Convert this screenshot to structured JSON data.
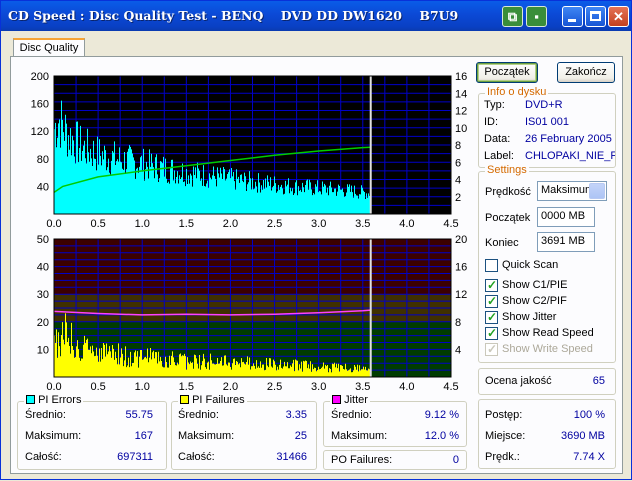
{
  "window": {
    "title": "CD Speed : Disc Quality Test - BENQ    DVD DD DW1620    B7U9"
  },
  "tab": {
    "label": "Disc Quality"
  },
  "buttons": {
    "start": "Początek",
    "finish": "Zakończ"
  },
  "disc_info": {
    "title": "Info o dysku",
    "rows": [
      {
        "label": "Typ:",
        "value": "DVD+R"
      },
      {
        "label": "ID:",
        "value": "IS01 001"
      },
      {
        "label": "Data:",
        "value": "26 February 2005"
      },
      {
        "label": "Label:",
        "value": "CHLOPAKI_NIE_F"
      }
    ]
  },
  "settings": {
    "title": "Settings",
    "speed_label": "Prędkość",
    "speed_value": "Maksimum",
    "start_label": "Początek",
    "start_value": "0000 MB",
    "end_label": "Koniec",
    "end_value": "3691 MB",
    "checkboxes": [
      {
        "label": "Quick Scan",
        "checked": false,
        "enabled": true
      },
      {
        "label": "Show C1/PIE",
        "checked": true,
        "enabled": true
      },
      {
        "label": "Show C2/PIF",
        "checked": true,
        "enabled": true
      },
      {
        "label": "Show Jitter",
        "checked": true,
        "enabled": true
      },
      {
        "label": "Show Read Speed",
        "checked": true,
        "enabled": true
      },
      {
        "label": "Show Write Speed",
        "checked": true,
        "enabled": false
      }
    ]
  },
  "quality": {
    "label": "Ocena jakość",
    "value": "65"
  },
  "progress": {
    "rows": [
      {
        "label": "Postęp:",
        "value": "100 %"
      },
      {
        "label": "Miejsce:",
        "value": "3690 MB"
      },
      {
        "label": "Prędk.:",
        "value": "7.74 X"
      }
    ]
  },
  "pi_errors": {
    "title": "PI Errors",
    "color": "#00ffff",
    "rows": [
      {
        "label": "Średnio:",
        "value": "55.75"
      },
      {
        "label": "Maksimum:",
        "value": "167"
      },
      {
        "label": "Całość:",
        "value": "697311"
      }
    ]
  },
  "pi_failures": {
    "title": "PI Failures",
    "color": "#ffff00",
    "rows": [
      {
        "label": "Średnio:",
        "value": "3.35"
      },
      {
        "label": "Maksimum:",
        "value": "25"
      },
      {
        "label": "Całość:",
        "value": "31466"
      }
    ]
  },
  "jitter": {
    "title": "Jitter",
    "color": "#ff00ff",
    "rows": [
      {
        "label": "Średnio:",
        "value": "9.12 %"
      },
      {
        "label": "Maksimum:",
        "value": "12.0 %"
      }
    ],
    "po_label": "PO Failures:",
    "po_value": "0"
  },
  "chart_data": [
    {
      "type": "area",
      "x_ticks": [
        "0.0",
        "0.5",
        "1.0",
        "1.5",
        "2.0",
        "2.5",
        "3.0",
        "3.5",
        "4.0",
        "4.5"
      ],
      "y_left_ticks": [
        "200",
        "160",
        "120",
        "80",
        "40"
      ],
      "y_right_ticks": [
        "16",
        "14",
        "12",
        "10",
        "8",
        "6",
        "4",
        "2"
      ],
      "xlim": [
        0,
        4.5
      ],
      "ylim_left": [
        0,
        200
      ],
      "ylim_right": [
        0,
        16
      ],
      "end_marker": 3.59,
      "colors": {
        "background": "#000000",
        "grid": "#0000c8",
        "pie": "#00ffff",
        "speed": "#00cc00",
        "marker": "#e0e0e0"
      },
      "series": [
        {
          "name": "PI Errors",
          "axis": "left",
          "envelope": [
            [
              0.0,
              150
            ],
            [
              0.05,
              167
            ],
            [
              0.15,
              140
            ],
            [
              0.3,
              118
            ],
            [
              0.5,
              105
            ],
            [
              0.75,
              95
            ],
            [
              1.0,
              88
            ],
            [
              1.25,
              80
            ],
            [
              1.5,
              73
            ],
            [
              1.75,
              67
            ],
            [
              2.0,
              61
            ],
            [
              2.25,
              56
            ],
            [
              2.5,
              52
            ],
            [
              2.75,
              48
            ],
            [
              3.0,
              45
            ],
            [
              3.25,
              42
            ],
            [
              3.5,
              38
            ],
            [
              3.59,
              36
            ]
          ]
        },
        {
          "name": "Read Speed",
          "axis": "right",
          "points": [
            [
              0.0,
              2.5
            ],
            [
              0.1,
              3.2
            ],
            [
              0.5,
              4.3
            ],
            [
              1.0,
              5.0
            ],
            [
              1.5,
              5.6
            ],
            [
              2.0,
              6.2
            ],
            [
              2.5,
              6.8
            ],
            [
              3.0,
              7.3
            ],
            [
              3.5,
              7.7
            ],
            [
              3.59,
              7.74
            ]
          ]
        }
      ]
    },
    {
      "type": "area",
      "x_ticks": [
        "0.0",
        "0.5",
        "1.0",
        "1.5",
        "2.0",
        "2.5",
        "3.0",
        "3.5",
        "4.0",
        "4.5"
      ],
      "y_left_ticks": [
        "50",
        "40",
        "30",
        "20",
        "10"
      ],
      "y_right_ticks": [
        "20",
        "16",
        "12",
        "8",
        "4"
      ],
      "xlim": [
        0,
        4.5
      ],
      "ylim_left": [
        0,
        50
      ],
      "ylim_right": [
        0,
        20
      ],
      "end_marker": 3.59,
      "colors": {
        "band_high": "#3c0000",
        "band_mid": "#403000",
        "band_low": "#003c00",
        "grid": "#0000c8",
        "pif": "#ffff00",
        "jitter": "#ff40ff",
        "marker": "#e0e0e0"
      },
      "bands": [
        {
          "from": 0,
          "to": 8,
          "color": "band_low"
        },
        {
          "from": 8,
          "to": 12,
          "color": "band_mid"
        },
        {
          "from": 12,
          "to": 20,
          "color": "band_high"
        }
      ],
      "series": [
        {
          "name": "PI Failures",
          "axis": "left",
          "envelope": [
            [
              0.0,
              18
            ],
            [
              0.1,
              22
            ],
            [
              0.25,
              16
            ],
            [
              0.5,
              13
            ],
            [
              0.75,
              11
            ],
            [
              1.0,
              10
            ],
            [
              1.25,
              9
            ],
            [
              1.5,
              8
            ],
            [
              1.75,
              8
            ],
            [
              2.0,
              7
            ],
            [
              2.25,
              7
            ],
            [
              2.5,
              6
            ],
            [
              2.75,
              6
            ],
            [
              3.0,
              5
            ],
            [
              3.25,
              5
            ],
            [
              3.5,
              4
            ],
            [
              3.59,
              4
            ]
          ]
        },
        {
          "name": "Jitter",
          "axis": "right",
          "points": [
            [
              0.0,
              9.5
            ],
            [
              0.5,
              9.2
            ],
            [
              1.0,
              9.0
            ],
            [
              1.5,
              9.1
            ],
            [
              2.0,
              9.0
            ],
            [
              2.5,
              9.1
            ],
            [
              3.0,
              9.3
            ],
            [
              3.5,
              9.6
            ],
            [
              3.59,
              9.7
            ]
          ]
        }
      ]
    }
  ]
}
